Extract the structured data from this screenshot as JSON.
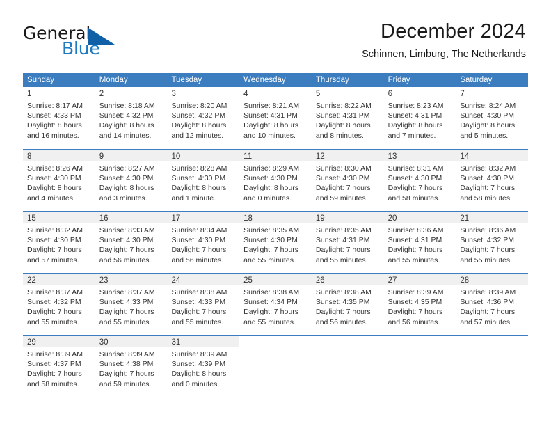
{
  "brand": {
    "word1": "General",
    "word2": "Blue",
    "triangle_color": "#1060a8",
    "blue_text_color": "#1f7bc1",
    "logo_icon": "triangle-icon"
  },
  "header": {
    "title": "December 2024",
    "subtitle": "Schinnen, Limburg, The Netherlands"
  },
  "theme": {
    "header_blue": "#3c7dbf",
    "row_shade": "#f0f0f0",
    "text": "#333333"
  },
  "calendar": {
    "day_headers": [
      "Sunday",
      "Monday",
      "Tuesday",
      "Wednesday",
      "Thursday",
      "Friday",
      "Saturday"
    ],
    "weeks": [
      {
        "shaded": false,
        "days": [
          {
            "num": "1",
            "sunrise": "Sunrise: 8:17 AM",
            "sunset": "Sunset: 4:33 PM",
            "daylight1": "Daylight: 8 hours",
            "daylight2": "and 16 minutes."
          },
          {
            "num": "2",
            "sunrise": "Sunrise: 8:18 AM",
            "sunset": "Sunset: 4:32 PM",
            "daylight1": "Daylight: 8 hours",
            "daylight2": "and 14 minutes."
          },
          {
            "num": "3",
            "sunrise": "Sunrise: 8:20 AM",
            "sunset": "Sunset: 4:32 PM",
            "daylight1": "Daylight: 8 hours",
            "daylight2": "and 12 minutes."
          },
          {
            "num": "4",
            "sunrise": "Sunrise: 8:21 AM",
            "sunset": "Sunset: 4:31 PM",
            "daylight1": "Daylight: 8 hours",
            "daylight2": "and 10 minutes."
          },
          {
            "num": "5",
            "sunrise": "Sunrise: 8:22 AM",
            "sunset": "Sunset: 4:31 PM",
            "daylight1": "Daylight: 8 hours",
            "daylight2": "and 8 minutes."
          },
          {
            "num": "6",
            "sunrise": "Sunrise: 8:23 AM",
            "sunset": "Sunset: 4:31 PM",
            "daylight1": "Daylight: 8 hours",
            "daylight2": "and 7 minutes."
          },
          {
            "num": "7",
            "sunrise": "Sunrise: 8:24 AM",
            "sunset": "Sunset: 4:30 PM",
            "daylight1": "Daylight: 8 hours",
            "daylight2": "and 5 minutes."
          }
        ]
      },
      {
        "shaded": true,
        "days": [
          {
            "num": "8",
            "sunrise": "Sunrise: 8:26 AM",
            "sunset": "Sunset: 4:30 PM",
            "daylight1": "Daylight: 8 hours",
            "daylight2": "and 4 minutes."
          },
          {
            "num": "9",
            "sunrise": "Sunrise: 8:27 AM",
            "sunset": "Sunset: 4:30 PM",
            "daylight1": "Daylight: 8 hours",
            "daylight2": "and 3 minutes."
          },
          {
            "num": "10",
            "sunrise": "Sunrise: 8:28 AM",
            "sunset": "Sunset: 4:30 PM",
            "daylight1": "Daylight: 8 hours",
            "daylight2": "and 1 minute."
          },
          {
            "num": "11",
            "sunrise": "Sunrise: 8:29 AM",
            "sunset": "Sunset: 4:30 PM",
            "daylight1": "Daylight: 8 hours",
            "daylight2": "and 0 minutes."
          },
          {
            "num": "12",
            "sunrise": "Sunrise: 8:30 AM",
            "sunset": "Sunset: 4:30 PM",
            "daylight1": "Daylight: 7 hours",
            "daylight2": "and 59 minutes."
          },
          {
            "num": "13",
            "sunrise": "Sunrise: 8:31 AM",
            "sunset": "Sunset: 4:30 PM",
            "daylight1": "Daylight: 7 hours",
            "daylight2": "and 58 minutes."
          },
          {
            "num": "14",
            "sunrise": "Sunrise: 8:32 AM",
            "sunset": "Sunset: 4:30 PM",
            "daylight1": "Daylight: 7 hours",
            "daylight2": "and 58 minutes."
          }
        ]
      },
      {
        "shaded": true,
        "days": [
          {
            "num": "15",
            "sunrise": "Sunrise: 8:32 AM",
            "sunset": "Sunset: 4:30 PM",
            "daylight1": "Daylight: 7 hours",
            "daylight2": "and 57 minutes."
          },
          {
            "num": "16",
            "sunrise": "Sunrise: 8:33 AM",
            "sunset": "Sunset: 4:30 PM",
            "daylight1": "Daylight: 7 hours",
            "daylight2": "and 56 minutes."
          },
          {
            "num": "17",
            "sunrise": "Sunrise: 8:34 AM",
            "sunset": "Sunset: 4:30 PM",
            "daylight1": "Daylight: 7 hours",
            "daylight2": "and 56 minutes."
          },
          {
            "num": "18",
            "sunrise": "Sunrise: 8:35 AM",
            "sunset": "Sunset: 4:30 PM",
            "daylight1": "Daylight: 7 hours",
            "daylight2": "and 55 minutes."
          },
          {
            "num": "19",
            "sunrise": "Sunrise: 8:35 AM",
            "sunset": "Sunset: 4:31 PM",
            "daylight1": "Daylight: 7 hours",
            "daylight2": "and 55 minutes."
          },
          {
            "num": "20",
            "sunrise": "Sunrise: 8:36 AM",
            "sunset": "Sunset: 4:31 PM",
            "daylight1": "Daylight: 7 hours",
            "daylight2": "and 55 minutes."
          },
          {
            "num": "21",
            "sunrise": "Sunrise: 8:36 AM",
            "sunset": "Sunset: 4:32 PM",
            "daylight1": "Daylight: 7 hours",
            "daylight2": "and 55 minutes."
          }
        ]
      },
      {
        "shaded": true,
        "days": [
          {
            "num": "22",
            "sunrise": "Sunrise: 8:37 AM",
            "sunset": "Sunset: 4:32 PM",
            "daylight1": "Daylight: 7 hours",
            "daylight2": "and 55 minutes."
          },
          {
            "num": "23",
            "sunrise": "Sunrise: 8:37 AM",
            "sunset": "Sunset: 4:33 PM",
            "daylight1": "Daylight: 7 hours",
            "daylight2": "and 55 minutes."
          },
          {
            "num": "24",
            "sunrise": "Sunrise: 8:38 AM",
            "sunset": "Sunset: 4:33 PM",
            "daylight1": "Daylight: 7 hours",
            "daylight2": "and 55 minutes."
          },
          {
            "num": "25",
            "sunrise": "Sunrise: 8:38 AM",
            "sunset": "Sunset: 4:34 PM",
            "daylight1": "Daylight: 7 hours",
            "daylight2": "and 55 minutes."
          },
          {
            "num": "26",
            "sunrise": "Sunrise: 8:38 AM",
            "sunset": "Sunset: 4:35 PM",
            "daylight1": "Daylight: 7 hours",
            "daylight2": "and 56 minutes."
          },
          {
            "num": "27",
            "sunrise": "Sunrise: 8:39 AM",
            "sunset": "Sunset: 4:35 PM",
            "daylight1": "Daylight: 7 hours",
            "daylight2": "and 56 minutes."
          },
          {
            "num": "28",
            "sunrise": "Sunrise: 8:39 AM",
            "sunset": "Sunset: 4:36 PM",
            "daylight1": "Daylight: 7 hours",
            "daylight2": "and 57 minutes."
          }
        ]
      },
      {
        "shaded": true,
        "days": [
          {
            "num": "29",
            "sunrise": "Sunrise: 8:39 AM",
            "sunset": "Sunset: 4:37 PM",
            "daylight1": "Daylight: 7 hours",
            "daylight2": "and 58 minutes."
          },
          {
            "num": "30",
            "sunrise": "Sunrise: 8:39 AM",
            "sunset": "Sunset: 4:38 PM",
            "daylight1": "Daylight: 7 hours",
            "daylight2": "and 59 minutes."
          },
          {
            "num": "31",
            "sunrise": "Sunrise: 8:39 AM",
            "sunset": "Sunset: 4:39 PM",
            "daylight1": "Daylight: 8 hours",
            "daylight2": "and 0 minutes."
          },
          {
            "num": "",
            "sunrise": "",
            "sunset": "",
            "daylight1": "",
            "daylight2": ""
          },
          {
            "num": "",
            "sunrise": "",
            "sunset": "",
            "daylight1": "",
            "daylight2": ""
          },
          {
            "num": "",
            "sunrise": "",
            "sunset": "",
            "daylight1": "",
            "daylight2": ""
          },
          {
            "num": "",
            "sunrise": "",
            "sunset": "",
            "daylight1": "",
            "daylight2": ""
          }
        ]
      }
    ]
  }
}
